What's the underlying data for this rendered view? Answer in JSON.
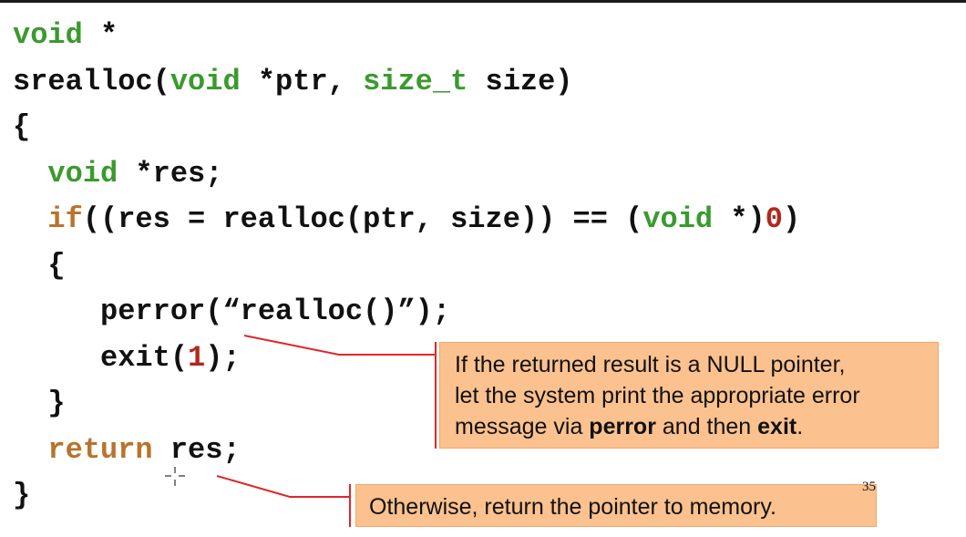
{
  "code": {
    "lines": [
      [
        {
          "t": "void",
          "c": "type"
        },
        {
          "t": " *",
          "c": "plain"
        }
      ],
      [
        {
          "t": "srealloc(",
          "c": "plain"
        },
        {
          "t": "void",
          "c": "type"
        },
        {
          "t": " *ptr, ",
          "c": "plain"
        },
        {
          "t": "size_t",
          "c": "type"
        },
        {
          "t": " size)",
          "c": "plain"
        }
      ],
      [
        {
          "t": "{",
          "c": "plain"
        }
      ],
      [
        {
          "t": "  ",
          "c": "plain"
        },
        {
          "t": "void",
          "c": "type"
        },
        {
          "t": " *res;",
          "c": "plain"
        }
      ],
      [
        {
          "t": "  ",
          "c": "plain"
        },
        {
          "t": "if",
          "c": "ctrl"
        },
        {
          "t": "((res = realloc(ptr, size)) == (",
          "c": "plain"
        },
        {
          "t": "void",
          "c": "type"
        },
        {
          "t": " *)",
          "c": "plain"
        },
        {
          "t": "0",
          "c": "num"
        },
        {
          "t": ")",
          "c": "plain"
        }
      ],
      [
        {
          "t": "  {",
          "c": "plain"
        }
      ],
      [
        {
          "t": "     perror(“realloc()”);",
          "c": "plain"
        }
      ],
      [
        {
          "t": "     exit(",
          "c": "plain"
        },
        {
          "t": "1",
          "c": "num"
        },
        {
          "t": ");",
          "c": "plain"
        }
      ],
      [
        {
          "t": "  }",
          "c": "plain"
        }
      ],
      [
        {
          "t": "  ",
          "c": "plain"
        },
        {
          "t": "return",
          "c": "ctrl"
        },
        {
          "t": " res;",
          "c": "plain"
        }
      ],
      [
        {
          "t": "}",
          "c": "plain"
        }
      ]
    ]
  },
  "callouts": {
    "null_check": {
      "line1": "If the returned result is a NULL pointer,",
      "line2": "let the system print the appropriate error",
      "line3_pre": "message via ",
      "line3_bold1": "perror",
      "line3_mid": " and then ",
      "line3_bold2": "exit",
      "line3_post": "."
    },
    "return": {
      "text": "Otherwise, return the pointer to memory."
    }
  },
  "page_number": "35",
  "colors": {
    "type_keyword": "#3a9a2e",
    "control_keyword": "#b8742c",
    "number_literal": "#b0291f",
    "callout_fill": "#fbc18e",
    "connector_line": "#e0262b"
  },
  "icons": {
    "cursor": "crosshair-cursor-icon"
  }
}
